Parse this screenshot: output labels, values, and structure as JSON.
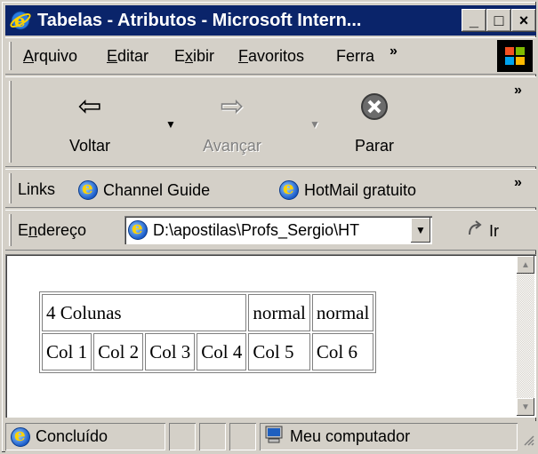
{
  "window": {
    "title": "Tabelas - Atributos - Microsoft Intern...",
    "min_glyph": "_",
    "max_glyph": "□",
    "close_glyph": "×"
  },
  "menu": {
    "items": [
      {
        "label": "Arquivo",
        "mnemonic": "A"
      },
      {
        "label": "Editar",
        "mnemonic": "E"
      },
      {
        "label": "Exibir",
        "mnemonic": "x"
      },
      {
        "label": "Favoritos",
        "mnemonic": "F"
      },
      {
        "label": "Ferra"
      }
    ],
    "overflow": "»"
  },
  "toolbar": {
    "back_label": "Voltar",
    "forward_label": "Avançar",
    "stop_label": "Parar",
    "overflow": "»"
  },
  "links": {
    "label": "Links",
    "items": [
      "Channel Guide",
      "HotMail gratuito"
    ],
    "overflow": "»"
  },
  "address": {
    "label": "Endereço",
    "value": "D:\\apostilas\\Profs_Sergio\\HT",
    "go_label": "Ir"
  },
  "table": {
    "row1": [
      "4 Colunas",
      "normal",
      "normal"
    ],
    "row2": [
      "Col 1",
      "Col 2",
      "Col 3",
      "Col 4",
      "Col 5",
      "Col 6"
    ]
  },
  "status": {
    "text": "Concluído",
    "zone": "Meu computador"
  }
}
